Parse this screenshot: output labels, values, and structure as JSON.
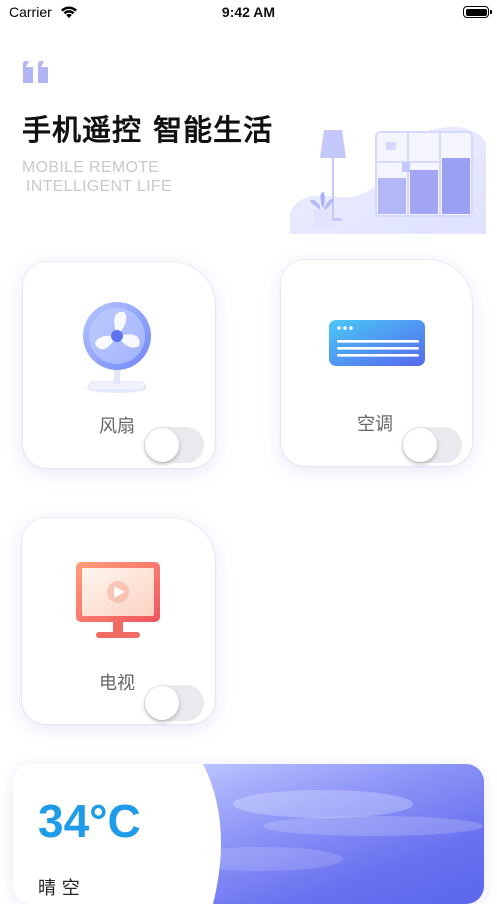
{
  "status_bar": {
    "carrier": "Carrier",
    "time": "9:42 AM"
  },
  "header": {
    "headline": "手机遥控 智能生活",
    "subtitle_line1": "MOBILE REMOTE",
    "subtitle_line2": "INTELLIGENT LIFE",
    "quote_icon": "quote-icon",
    "illustration_icon": "room-illustration"
  },
  "devices": [
    {
      "label": "风扇",
      "icon": "fan-icon",
      "on": false
    },
    {
      "label": "空调",
      "icon": "air-conditioner-icon",
      "on": false
    },
    {
      "label": "电视",
      "icon": "tv-icon",
      "on": false
    }
  ],
  "weather": {
    "temperature": "34°C",
    "condition": "晴 空"
  },
  "colors": {
    "accent": "#6f78f0",
    "temperature": "#1e9be9",
    "toggle_off": "#e9e9ee"
  }
}
